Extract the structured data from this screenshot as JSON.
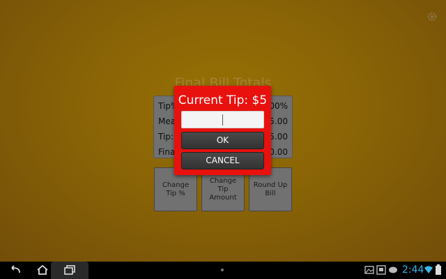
{
  "app": {
    "title": "Final Bill Totals"
  },
  "totals": {
    "rows": [
      {
        "label": "Tip%",
        "value": "00%"
      },
      {
        "label": "Mea",
        "value": "5.00"
      },
      {
        "label": "Tip:",
        "value": "5.00"
      },
      {
        "label": "Fina",
        "value": "0.00"
      }
    ]
  },
  "actions": {
    "change_tip_pct": "Change Tip %",
    "change_tip_amount": "Change Tip Amount",
    "round_up": "Round Up Bill"
  },
  "dialog": {
    "title": "Current Tip: $5",
    "input_value": "",
    "ok": "OK",
    "cancel": "CANCEL"
  },
  "status": {
    "time": "2:44"
  },
  "colors": {
    "dialog_bg": "#e8110e",
    "background": "#a87a08",
    "clock": "#39b6e8"
  }
}
